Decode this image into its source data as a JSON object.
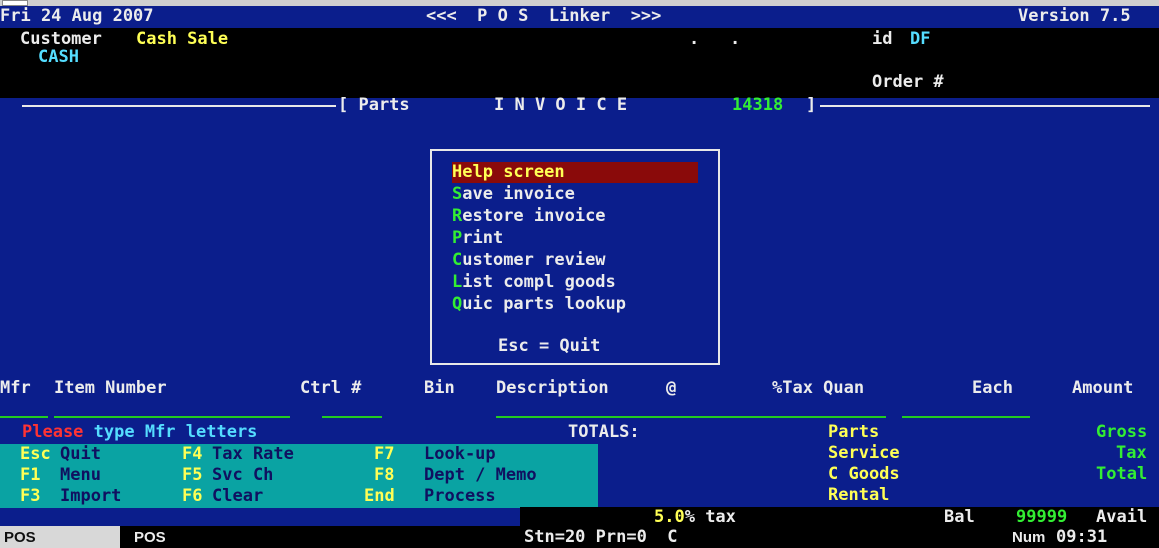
{
  "header": {
    "date": "Fri 24 Aug 2007",
    "app_title": "<<<  P O S  Linker  >>>",
    "version": "Version 7.5",
    "customer_label": "Customer",
    "customer_value": "Cash Sale",
    "customer_code": "CASH",
    "dots": ".   .",
    "id_label": "id",
    "id_value": "DF",
    "order_label": "Order #"
  },
  "invoice_bar": {
    "parts_label": "[ Parts",
    "invoice_label": "I N V O I C E",
    "invoice_number": "14318",
    "close_bracket": "]"
  },
  "popup_menu": {
    "items": [
      {
        "hotkey": "H",
        "rest": "elp screen",
        "selected": true
      },
      {
        "hotkey": "S",
        "rest": "ave invoice"
      },
      {
        "hotkey": "R",
        "rest": "estore invoice"
      },
      {
        "hotkey": "P",
        "rest": "rint"
      },
      {
        "hotkey": "C",
        "rest": "ustomer review"
      },
      {
        "hotkey": "L",
        "rest": "ist compl goods"
      },
      {
        "hotkey": "Q",
        "rest": "uic parts lookup"
      }
    ],
    "footer": "Esc = Quit"
  },
  "columns": {
    "mfr": "Mfr",
    "item_number": "Item Number",
    "ctrl": "Ctrl #",
    "bin": "Bin",
    "description": "Description",
    "at": "@",
    "tax_quan": "%Tax Quan",
    "each": "Each",
    "amount": "Amount"
  },
  "prompt": {
    "please": "Please",
    "message": " type Mfr letters"
  },
  "totals": {
    "label": "TOTALS:",
    "parts": "Parts",
    "service": "Service",
    "c_goods": "C Goods",
    "rental": "Rental",
    "gross": "Gross",
    "tax": "Tax",
    "total": "Total"
  },
  "function_keys": [
    {
      "key": "Esc",
      "label": "Quit"
    },
    {
      "key": "F1",
      "label": "Menu"
    },
    {
      "key": "F3",
      "label": "Import"
    },
    {
      "key": "F4",
      "label": "Tax Rate"
    },
    {
      "key": "F5",
      "label": "Svc Ch"
    },
    {
      "key": "F6",
      "label": "Clear"
    },
    {
      "key": "F7",
      "label": "Look-up"
    },
    {
      "key": "F8",
      "label": "Dept / Memo"
    },
    {
      "key": "End",
      "label": "Process"
    }
  ],
  "tax_line": {
    "rate": "5.0",
    "suffix": "% tax",
    "bal_label": "Bal",
    "avail_value": "99999",
    "avail_label": "Avail"
  },
  "status": {
    "tab1": "POS",
    "tab2": "POS",
    "station": "Stn=20 Prn=0  C",
    "num": "Num",
    "time": "09:31"
  },
  "colors": {
    "background": "#0b1e8c",
    "menu_selected": "#8a0a0a",
    "function_bar": "#0aa3a3",
    "hotkey": "#33ee33",
    "accent_yellow": "#ffff55",
    "accent_cyan": "#55ddff"
  }
}
